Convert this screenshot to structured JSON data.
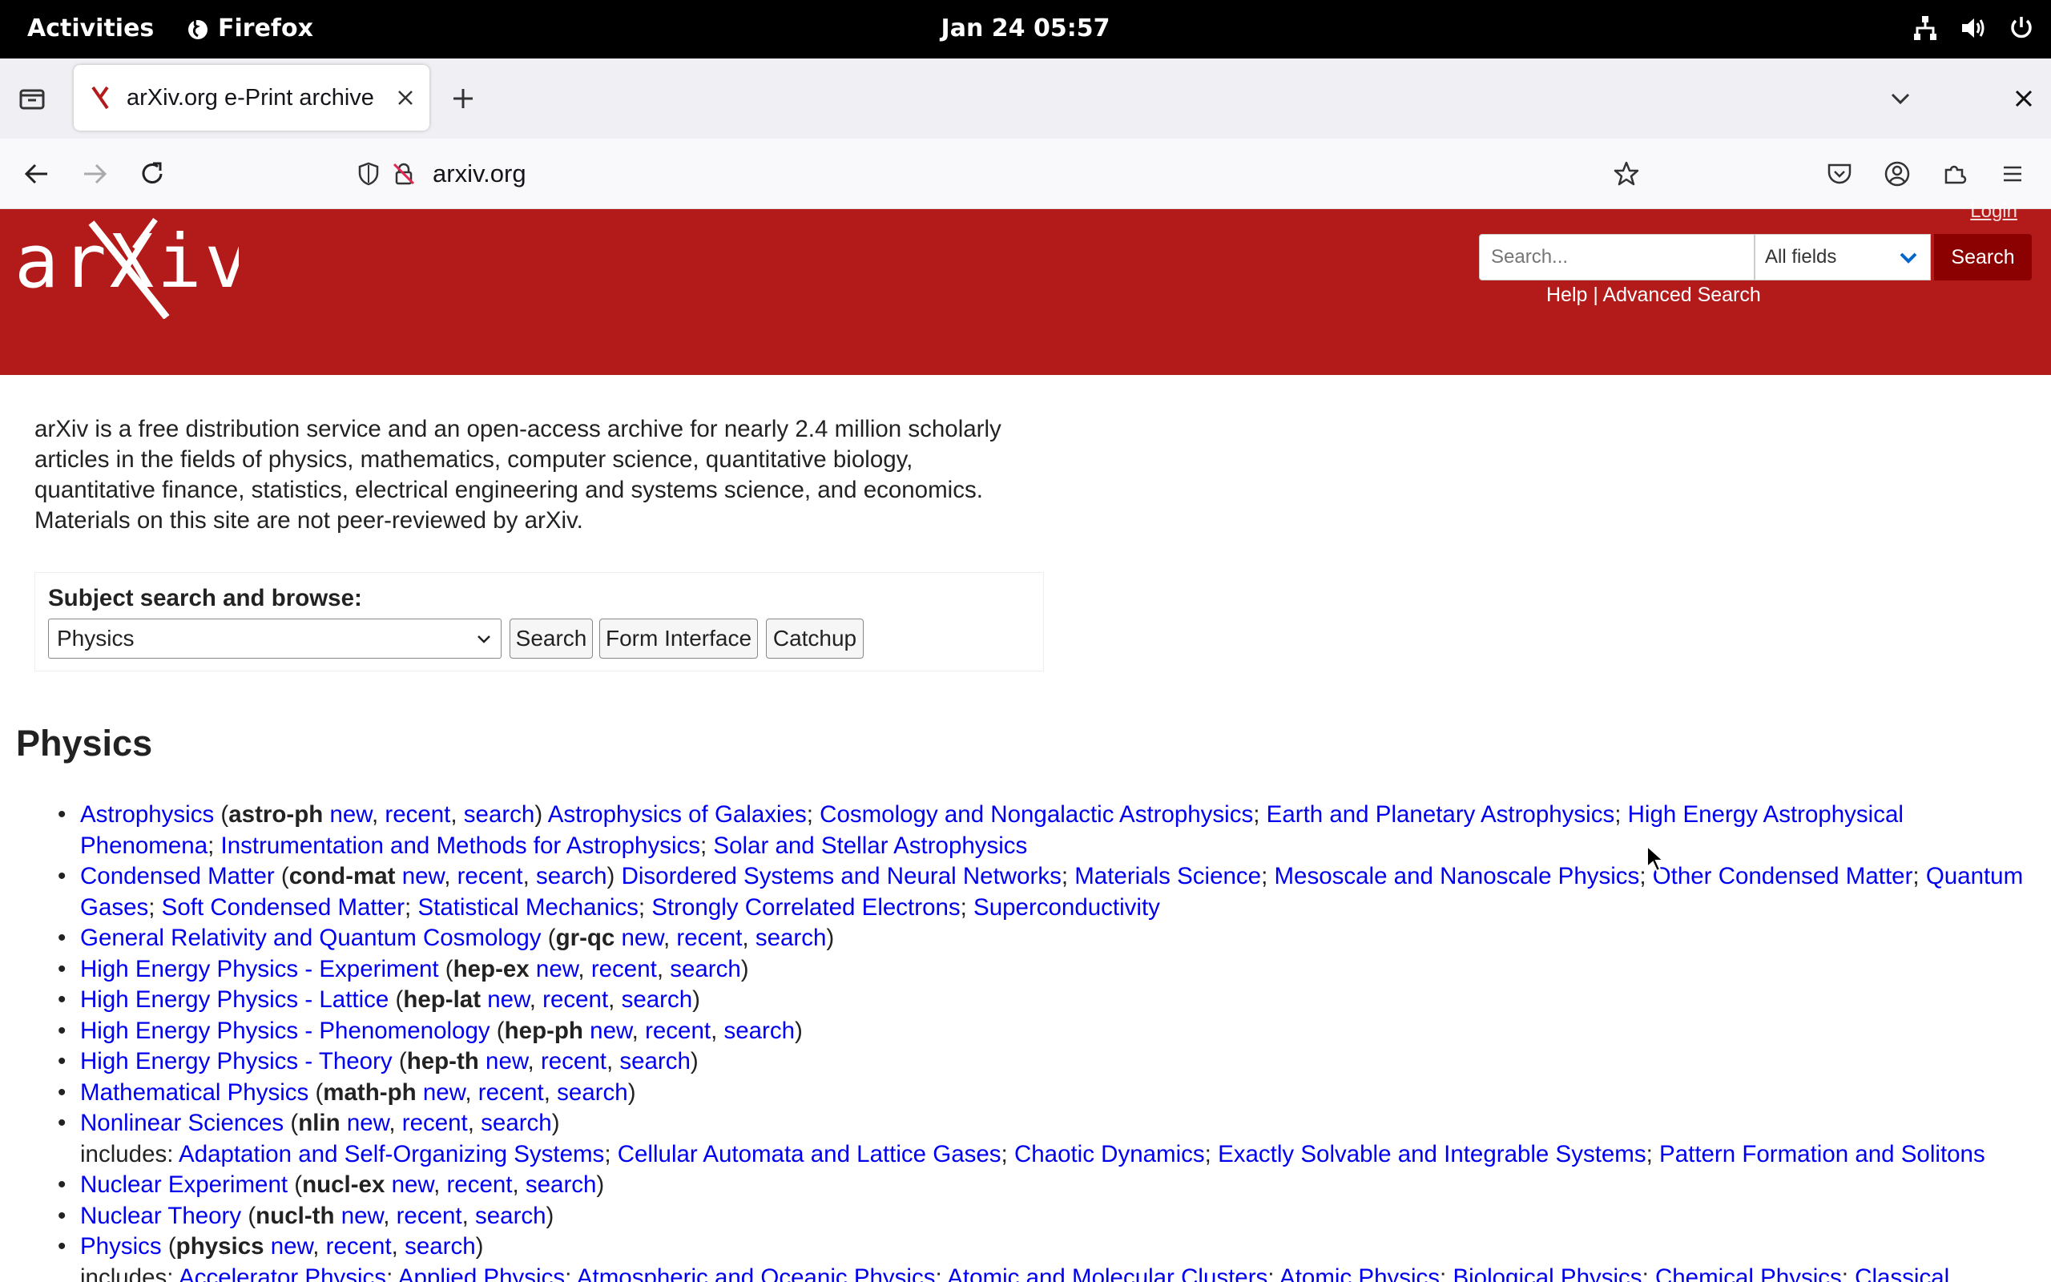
{
  "system": {
    "activities": "Activities",
    "app_name": "Firefox",
    "clock": "Jan 24  05:57"
  },
  "browser": {
    "tab_title": "arXiv.org e-Print archive",
    "url": "arxiv.org"
  },
  "header": {
    "login": "Login",
    "search_placeholder": "Search...",
    "field_selected": "All fields",
    "search_button": "Search",
    "help": "Help",
    "separator": " | ",
    "advanced": "Advanced Search",
    "brand_color": "#b31b1b"
  },
  "intro": "arXiv is a free distribution service and an open-access archive for nearly 2.4 million scholarly articles in the fields of physics, mathematics, computer science, quantitative biology, quantitative finance, statistics, electrical engineering and systems science, and economics. Materials on this site are not peer-reviewed by arXiv.",
  "subject": {
    "label": "Subject search and browse:",
    "selected": "Physics",
    "search": "Search",
    "form": "Form Interface",
    "catchup": "Catchup"
  },
  "section": {
    "title": "Physics"
  },
  "links": {
    "new": "new",
    "recent": "recent",
    "search": "search",
    "includes": "includes:"
  },
  "archives": [
    {
      "name": "Astrophysics",
      "code": "astro-ph",
      "subs": [
        "Astrophysics of Galaxies",
        "Cosmology and Nongalactic Astrophysics",
        "Earth and Planetary Astrophysics",
        "High Energy Astrophysical Phenomena",
        "Instrumentation and Methods for Astrophysics",
        "Solar and Stellar Astrophysics"
      ]
    },
    {
      "name": "Condensed Matter",
      "code": "cond-mat",
      "subs": [
        "Disordered Systems and Neural Networks",
        "Materials Science",
        "Mesoscale and Nanoscale Physics",
        "Other Condensed Matter",
        "Quantum Gases",
        "Soft Condensed Matter",
        "Statistical Mechanics",
        "Strongly Correlated Electrons",
        "Superconductivity"
      ]
    },
    {
      "name": "General Relativity and Quantum Cosmology",
      "code": "gr-qc"
    },
    {
      "name": "High Energy Physics - Experiment",
      "code": "hep-ex"
    },
    {
      "name": "High Energy Physics - Lattice",
      "code": "hep-lat"
    },
    {
      "name": "High Energy Physics - Phenomenology",
      "code": "hep-ph"
    },
    {
      "name": "High Energy Physics - Theory",
      "code": "hep-th"
    },
    {
      "name": "Mathematical Physics",
      "code": "math-ph"
    },
    {
      "name": "Nonlinear Sciences",
      "code": "nlin",
      "includes": [
        "Adaptation and Self-Organizing Systems",
        "Cellular Automata and Lattice Gases",
        "Chaotic Dynamics",
        "Exactly Solvable and Integrable Systems",
        "Pattern Formation and Solitons"
      ]
    },
    {
      "name": "Nuclear Experiment",
      "code": "nucl-ex"
    },
    {
      "name": "Nuclear Theory",
      "code": "nucl-th"
    },
    {
      "name": "Physics",
      "code": "physics",
      "includes": [
        "Accelerator Physics",
        "Applied Physics",
        "Atmospheric and Oceanic Physics",
        "Atomic and Molecular Clusters",
        "Atomic Physics",
        "Biological Physics",
        "Chemical Physics",
        "Classical Physics"
      ]
    }
  ]
}
